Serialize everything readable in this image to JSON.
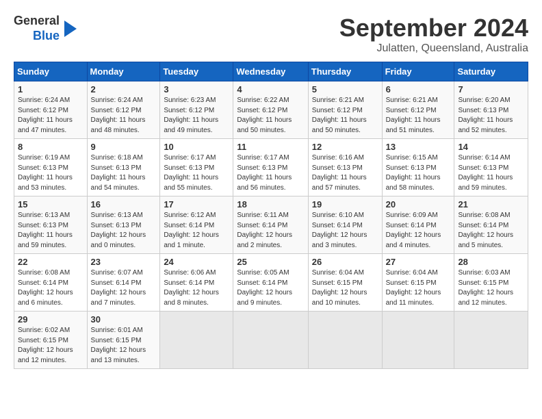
{
  "logo": {
    "line1": "General",
    "line2": "Blue"
  },
  "title": "September 2024",
  "subtitle": "Julatten, Queensland, Australia",
  "headers": [
    "Sunday",
    "Monday",
    "Tuesday",
    "Wednesday",
    "Thursday",
    "Friday",
    "Saturday"
  ],
  "weeks": [
    [
      {
        "day": "1",
        "sunrise": "6:24 AM",
        "sunset": "6:12 PM",
        "daylight": "11 hours and 47 minutes."
      },
      {
        "day": "2",
        "sunrise": "6:24 AM",
        "sunset": "6:12 PM",
        "daylight": "11 hours and 48 minutes."
      },
      {
        "day": "3",
        "sunrise": "6:23 AM",
        "sunset": "6:12 PM",
        "daylight": "11 hours and 49 minutes."
      },
      {
        "day": "4",
        "sunrise": "6:22 AM",
        "sunset": "6:12 PM",
        "daylight": "11 hours and 50 minutes."
      },
      {
        "day": "5",
        "sunrise": "6:21 AM",
        "sunset": "6:12 PM",
        "daylight": "11 hours and 50 minutes."
      },
      {
        "day": "6",
        "sunrise": "6:21 AM",
        "sunset": "6:12 PM",
        "daylight": "11 hours and 51 minutes."
      },
      {
        "day": "7",
        "sunrise": "6:20 AM",
        "sunset": "6:13 PM",
        "daylight": "11 hours and 52 minutes."
      }
    ],
    [
      {
        "day": "8",
        "sunrise": "6:19 AM",
        "sunset": "6:13 PM",
        "daylight": "11 hours and 53 minutes."
      },
      {
        "day": "9",
        "sunrise": "6:18 AM",
        "sunset": "6:13 PM",
        "daylight": "11 hours and 54 minutes."
      },
      {
        "day": "10",
        "sunrise": "6:17 AM",
        "sunset": "6:13 PM",
        "daylight": "11 hours and 55 minutes."
      },
      {
        "day": "11",
        "sunrise": "6:17 AM",
        "sunset": "6:13 PM",
        "daylight": "11 hours and 56 minutes."
      },
      {
        "day": "12",
        "sunrise": "6:16 AM",
        "sunset": "6:13 PM",
        "daylight": "11 hours and 57 minutes."
      },
      {
        "day": "13",
        "sunrise": "6:15 AM",
        "sunset": "6:13 PM",
        "daylight": "11 hours and 58 minutes."
      },
      {
        "day": "14",
        "sunrise": "6:14 AM",
        "sunset": "6:13 PM",
        "daylight": "11 hours and 59 minutes."
      }
    ],
    [
      {
        "day": "15",
        "sunrise": "6:13 AM",
        "sunset": "6:13 PM",
        "daylight": "11 hours and 59 minutes."
      },
      {
        "day": "16",
        "sunrise": "6:13 AM",
        "sunset": "6:13 PM",
        "daylight": "12 hours and 0 minutes."
      },
      {
        "day": "17",
        "sunrise": "6:12 AM",
        "sunset": "6:14 PM",
        "daylight": "12 hours and 1 minute."
      },
      {
        "day": "18",
        "sunrise": "6:11 AM",
        "sunset": "6:14 PM",
        "daylight": "12 hours and 2 minutes."
      },
      {
        "day": "19",
        "sunrise": "6:10 AM",
        "sunset": "6:14 PM",
        "daylight": "12 hours and 3 minutes."
      },
      {
        "day": "20",
        "sunrise": "6:09 AM",
        "sunset": "6:14 PM",
        "daylight": "12 hours and 4 minutes."
      },
      {
        "day": "21",
        "sunrise": "6:08 AM",
        "sunset": "6:14 PM",
        "daylight": "12 hours and 5 minutes."
      }
    ],
    [
      {
        "day": "22",
        "sunrise": "6:08 AM",
        "sunset": "6:14 PM",
        "daylight": "12 hours and 6 minutes."
      },
      {
        "day": "23",
        "sunrise": "6:07 AM",
        "sunset": "6:14 PM",
        "daylight": "12 hours and 7 minutes."
      },
      {
        "day": "24",
        "sunrise": "6:06 AM",
        "sunset": "6:14 PM",
        "daylight": "12 hours and 8 minutes."
      },
      {
        "day": "25",
        "sunrise": "6:05 AM",
        "sunset": "6:14 PM",
        "daylight": "12 hours and 9 minutes."
      },
      {
        "day": "26",
        "sunrise": "6:04 AM",
        "sunset": "6:15 PM",
        "daylight": "12 hours and 10 minutes."
      },
      {
        "day": "27",
        "sunrise": "6:04 AM",
        "sunset": "6:15 PM",
        "daylight": "12 hours and 11 minutes."
      },
      {
        "day": "28",
        "sunrise": "6:03 AM",
        "sunset": "6:15 PM",
        "daylight": "12 hours and 12 minutes."
      }
    ],
    [
      {
        "day": "29",
        "sunrise": "6:02 AM",
        "sunset": "6:15 PM",
        "daylight": "12 hours and 12 minutes."
      },
      {
        "day": "30",
        "sunrise": "6:01 AM",
        "sunset": "6:15 PM",
        "daylight": "12 hours and 13 minutes."
      },
      null,
      null,
      null,
      null,
      null
    ]
  ]
}
